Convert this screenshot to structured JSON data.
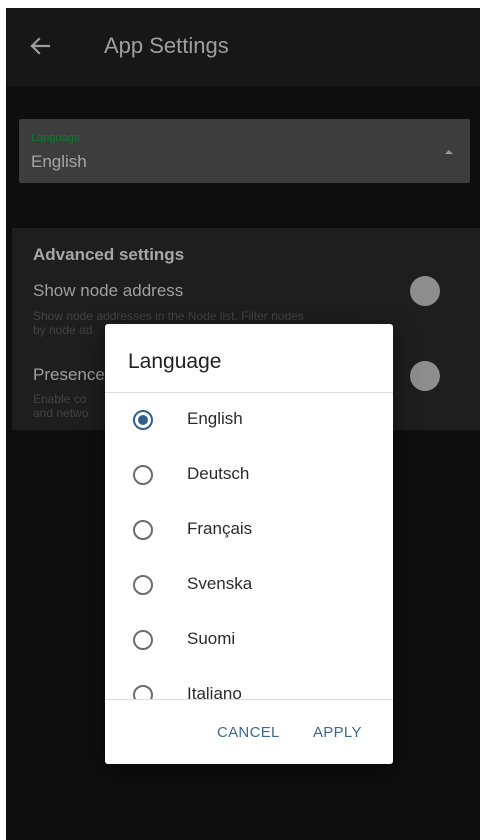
{
  "app_bar": {
    "title": "App Settings",
    "back_icon": "arrow-left-icon"
  },
  "language_field": {
    "label": "Language",
    "value": "English",
    "label_color": "#1aa642",
    "caret_icon": "triangle-up-icon"
  },
  "advanced": {
    "title": "Advanced settings",
    "items": [
      {
        "title": "Show node address",
        "description_line1": "Show node addresses in the Node list. Filter nodes",
        "description_line2": "by node ad",
        "enabled": false
      },
      {
        "title": "Presence",
        "description_line1": "Enable co",
        "description_line2": "and netwo",
        "enabled": false
      }
    ]
  },
  "dialog": {
    "title": "Language",
    "selected_index": 0,
    "options": [
      {
        "label": "English",
        "selected": true
      },
      {
        "label": "Deutsch",
        "selected": false
      },
      {
        "label": "Français",
        "selected": false
      },
      {
        "label": "Svenska",
        "selected": false
      },
      {
        "label": "Suomi",
        "selected": false
      },
      {
        "label": "Italiano",
        "selected": false
      }
    ],
    "cancel_label": "CANCEL",
    "apply_label": "APPLY",
    "accent_color": "#30608f"
  }
}
